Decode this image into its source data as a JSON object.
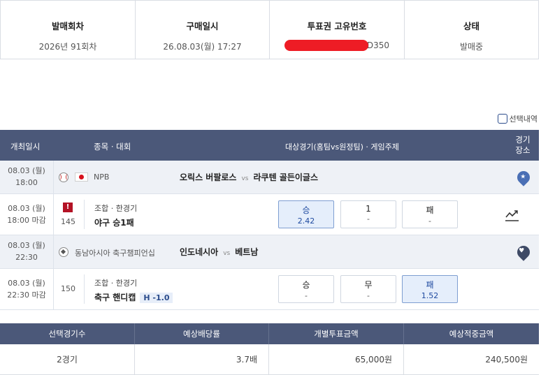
{
  "summary": {
    "round_label": "발매회차",
    "round_value": "2026년 91회차",
    "purchase_label": "구매일시",
    "purchase_value": "26.08.03(월) 17:27",
    "ticket_label": "투표권 고유번호",
    "ticket_value_suffix": "D350",
    "status_label": "상태",
    "status_value": "발매중"
  },
  "selection_toggle": "선택내역",
  "table": {
    "headers": {
      "date": "개최일시",
      "sport": "종목 · 대회",
      "game": "대상경기(홈팀vs원정팀) · 게임주제",
      "place": "경기 장소"
    },
    "games": [
      {
        "match_date": "08.03 (월)",
        "match_time": "18:00",
        "sport_icon": "baseball-icon",
        "flag": "japan-flag-icon",
        "league": "NPB",
        "home": "오릭스 버팔로스",
        "vs": "vs",
        "away": "라쿠텐 골든이글스",
        "place_icon": "star-pin-icon",
        "bet": {
          "date": "08.03 (월)",
          "time": "18:00 마감",
          "alert": "!",
          "game_no": "145",
          "type": "조합 · 한경기",
          "name": "야구 승1패",
          "handicap": "",
          "options": [
            {
              "label": "승",
              "odds": "2.42",
              "selected": true
            },
            {
              "label": "1",
              "odds": "-",
              "selected": false
            },
            {
              "label": "패",
              "odds": "-",
              "selected": false
            }
          ],
          "chart_icon": "trend-chart-icon"
        }
      },
      {
        "match_date": "08.03 (월)",
        "match_time": "22:30",
        "sport_icon": "soccer-ball-icon",
        "league": "동남아시아 축구챔피언십",
        "home": "인도네시아",
        "vs": "vs",
        "away": "베트남",
        "place_icon": "heart-pin-icon",
        "bet": {
          "date": "08.03 (월)",
          "time": "22:30 마감",
          "game_no": "150",
          "type": "조합 · 한경기",
          "name": "축구 핸디캡",
          "handicap": "H -1.0",
          "options": [
            {
              "label": "승",
              "odds": "-",
              "selected": false
            },
            {
              "label": "무",
              "odds": "-",
              "selected": false
            },
            {
              "label": "패",
              "odds": "1.52",
              "selected": true
            }
          ]
        }
      }
    ]
  },
  "totals": {
    "headers": [
      "선택경기수",
      "예상배당률",
      "개별투표금액",
      "예상적중금액"
    ],
    "values": [
      "2경기",
      "3.7배",
      "65,000원",
      "240,500원"
    ]
  },
  "colors": {
    "header_bg": "#4b5879",
    "selected_bg": "#e5eefb",
    "redaction": "#ee1c25"
  }
}
